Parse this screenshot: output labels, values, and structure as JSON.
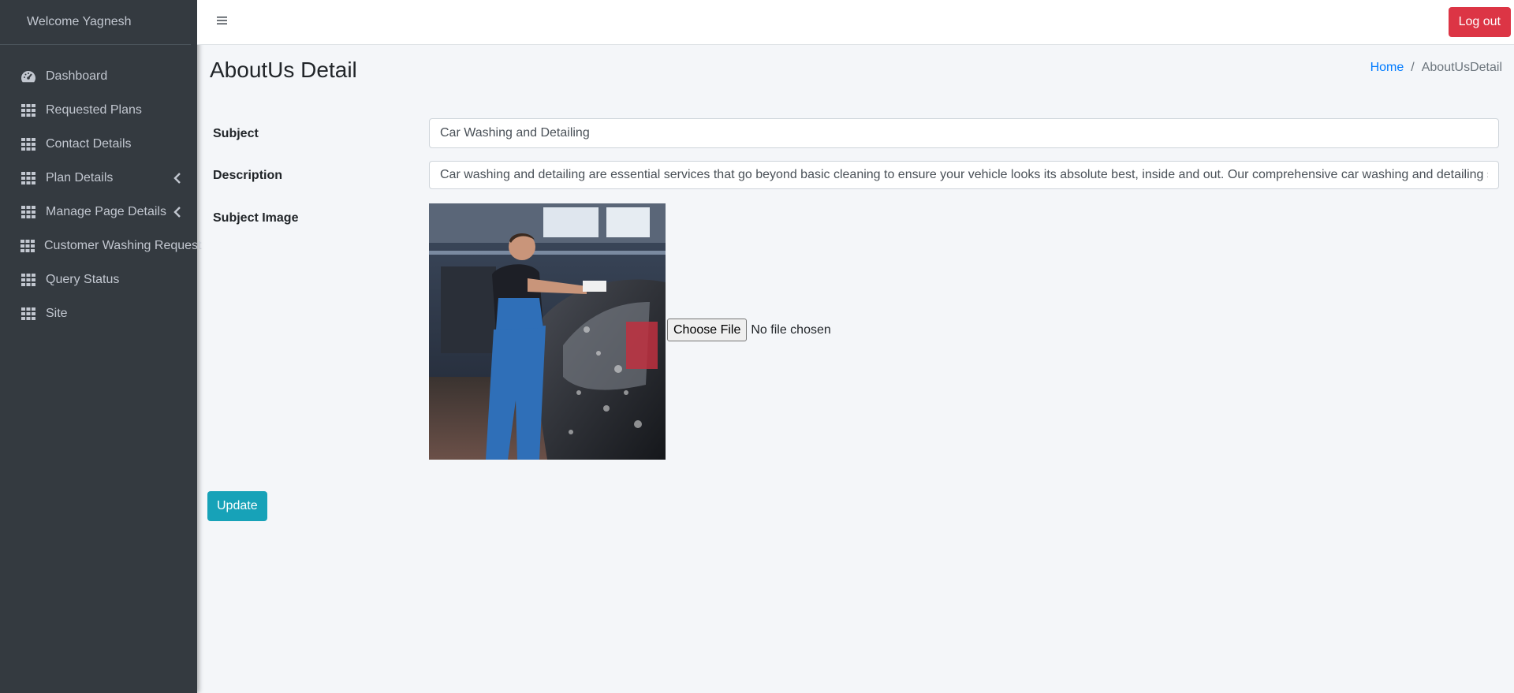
{
  "sidebar": {
    "welcome": "Welcome Yagnesh",
    "items": [
      {
        "label": "Dashboard",
        "icon": "tachometer-icon"
      },
      {
        "label": "Requested Plans",
        "icon": "grid-icon"
      },
      {
        "label": "Contact Details",
        "icon": "grid-icon"
      },
      {
        "label": "Plan Details",
        "icon": "grid-icon",
        "has_arrow": true
      },
      {
        "label": "Manage Page Details",
        "icon": "grid-icon",
        "has_arrow": true
      },
      {
        "label": "Customer Washing Request",
        "icon": "grid-icon"
      },
      {
        "label": "Query Status",
        "icon": "grid-icon"
      },
      {
        "label": "Site",
        "icon": "grid-icon"
      }
    ]
  },
  "header": {
    "menu_icon": "hamburger-icon",
    "logout_label": "Log out"
  },
  "page": {
    "title": "AboutUs Detail",
    "breadcrumb": {
      "home": "Home",
      "separator": "/",
      "current": "AboutUsDetail"
    }
  },
  "form": {
    "subject_label": "Subject",
    "subject_value": "Car Washing and Detailing",
    "description_label": "Description",
    "description_value": "Car washing and detailing are essential services that go beyond basic cleaning to ensure your vehicle looks its absolute best, inside and out. Our comprehensive car washing and detailing services are de",
    "image_label": "Subject Image",
    "choose_file_label": "Choose File",
    "no_file_text": "No file chosen",
    "update_label": "Update"
  },
  "colors": {
    "sidebar_bg": "#343a40",
    "logout": "#dc3545",
    "update": "#17a2b8",
    "link": "#007bff"
  }
}
